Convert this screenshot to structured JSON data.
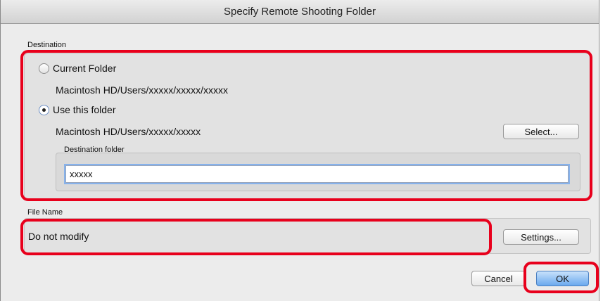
{
  "window": {
    "title": "Specify Remote Shooting Folder"
  },
  "destination": {
    "section_label": "Destination",
    "current_folder": {
      "label": "Current Folder",
      "path": "Macintosh HD/Users/xxxxx/xxxxx/xxxxx",
      "selected": false
    },
    "use_this_folder": {
      "label": "Use this folder",
      "path": "Macintosh HD/Users/xxxxx/xxxxx",
      "selected": true
    },
    "select_button": "Select...",
    "destination_folder_label": "Destination folder",
    "destination_folder_value": "xxxxx"
  },
  "file_name": {
    "section_label": "File Name",
    "value": "Do not modify",
    "settings_button": "Settings..."
  },
  "footer": {
    "cancel_button": "Cancel",
    "ok_button": "OK"
  },
  "colors": {
    "highlight": "#e8001c",
    "default_button": "#6aa9ee",
    "focus_ring": "#86b2ec"
  }
}
